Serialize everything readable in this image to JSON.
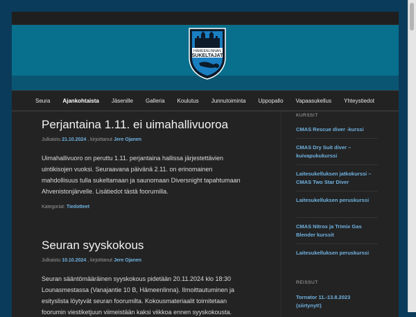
{
  "nav": {
    "items": [
      "Seura",
      "Ajankohtaista",
      "Jäsenille",
      "Galleria",
      "Koulutus",
      "Junnutoiminta",
      "Uppopallo",
      "Vapaasukellus",
      "Yhteystiedot"
    ],
    "active": "Ajankohtaista"
  },
  "logo": {
    "line1": "HÄMEENLINNAN",
    "line2": "SUKELTAJAT"
  },
  "posts": [
    {
      "title": "Perjantaina 1.11. ei uimahallivuoroa",
      "meta_prefix": "Julkaistu",
      "date": "21.10.2024",
      "meta_by": ", kirjoittanut",
      "author": "Jere Ojanen",
      "body": "Uimahallivuoro on peruttu 1.11. perjantaina hallissa järjestettävien uintikisojen vuoksi. Seuraavana päivänä 2.11. on erinomainen mahdollisuus tulla sukeltamaan ja saunomaan Diversnight tapahtumaan Ahvenistonjärvelle. Lisätiedot tästä foorumilla.",
      "category_label": "Kategoriat:",
      "category": "Tiedotteet"
    },
    {
      "title": "Seuran syyskokous",
      "meta_prefix": "Julkaistu",
      "date": "10.10.2024",
      "meta_by": ", kirjoittanut",
      "author": "Jere Ojanen",
      "body": "Seuran sääntömääräinen syyskokous pidetään 20.11.2024 klo 18:30 Lounasmestassa (Vanajantie 10 B, Hämeenlinna). Ilmoittautuminen ja esityslista löytyvät seuran foorumilta. Kokousmateriaalit toimitetaan foorumin viestiketjuun viimeistään kaksi viikkoa ennen syyskokousta."
    }
  ],
  "sidebar": {
    "courses_heading": "KURSSIT",
    "courses": [
      "CMAS Rescue diver -kurssi",
      "CMAS Dry Suit diver – kuivapukukurssi",
      "Laitesukelluksen jatkokurssi – CMAS Two Star Diver",
      "Laitesukelluksen peruskurssi",
      "CMAS Nitrox ja Trimix Gas Blender kurssit",
      "Laitesukelluksen peruskurssi"
    ],
    "trips_heading": "REISSUT",
    "trips": [
      "Tornator 11.-13.8.2023 (siirtynyt!)"
    ]
  },
  "colors": {
    "link": "#6fb2e0",
    "banner": "#08708c",
    "background": "#0b3b5a"
  }
}
